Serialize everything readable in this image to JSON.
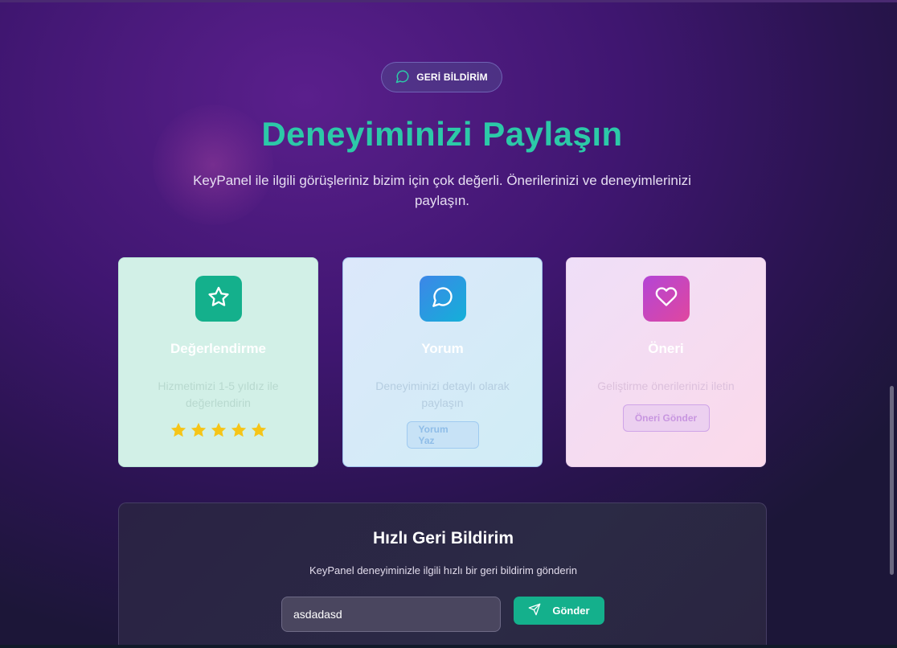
{
  "badge": {
    "label": "GERİ BİLDİRİM",
    "icon": "message-circle-icon"
  },
  "hero": {
    "title": "Deneyiminizi Paylaşın",
    "subtitle": "KeyPanel ile ilgili görüşleriniz bizim için çok değerli. Önerilerinizi ve deneyimlerinizi paylaşın."
  },
  "cards": [
    {
      "title": "Değerlendirme",
      "description": "Hizmetimizi 1-5 yıldız ile değerlendirin",
      "icon": "star-icon",
      "rating": 5,
      "rating_max": 5
    },
    {
      "title": "Yorum",
      "description": "Deneyiminizi detaylı olarak paylaşın",
      "icon": "message-circle-icon",
      "button_label": "Yorum Yaz"
    },
    {
      "title": "Öneri",
      "description": "Geliştirme önerilerinizi iletin",
      "icon": "heart-icon",
      "button_label": "Öneri Gönder"
    }
  ],
  "quick_feedback": {
    "title": "Hızlı Geri Bildirim",
    "subtitle": "KeyPanel deneyiminizle ilgili hızlı bir geri bildirim gönderin",
    "input_value": "asdadasd",
    "send_label": "Gönder",
    "send_icon": "send-icon"
  },
  "colors": {
    "accent": "#2cc9a8",
    "green": "#14b08c",
    "star": "#f5c518"
  }
}
